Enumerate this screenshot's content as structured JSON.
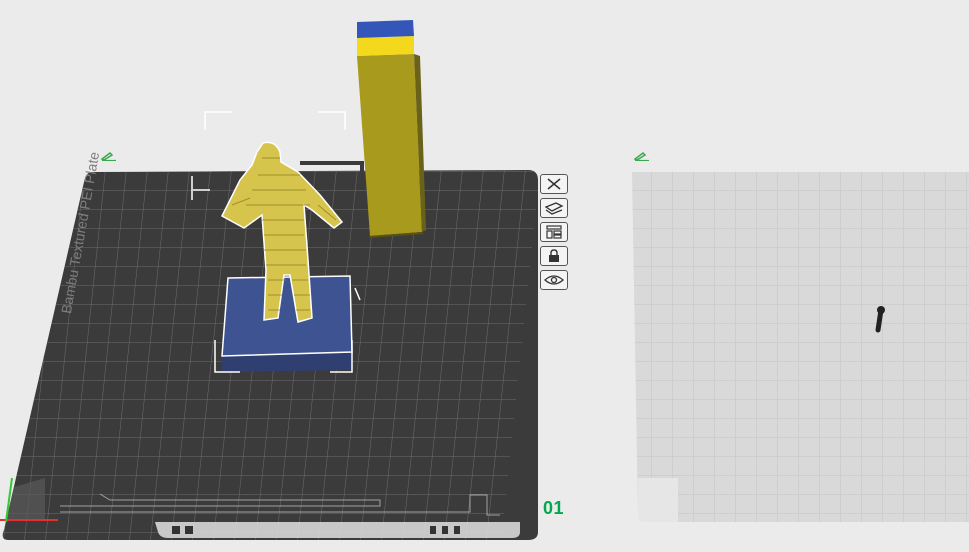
{
  "plate_1": {
    "surface_name": "Bambu Textured PEI Plate",
    "index_label": "01",
    "objects": [
      {
        "name": "figure-model",
        "color": "#d6c44c"
      },
      {
        "name": "base-block",
        "color": "#3e5392"
      },
      {
        "name": "wipe-tower",
        "colors": [
          "#a89a1c",
          "#f4d81c",
          "#3356b8"
        ]
      }
    ],
    "toolbar": [
      {
        "id": "delete-plate",
        "icon": "close-icon"
      },
      {
        "id": "orient-plate",
        "icon": "orient-icon"
      },
      {
        "id": "arrange-plate",
        "icon": "arrange-icon"
      },
      {
        "id": "lock-plate",
        "icon": "lock-icon"
      },
      {
        "id": "plate-settings",
        "icon": "eye-icon"
      }
    ]
  },
  "plate_2": {
    "objects": [
      {
        "name": "small-object",
        "color": "#222222"
      }
    ]
  },
  "colors": {
    "accent": "#00a94f",
    "active_plate": "#3b3b3b",
    "inactive_plate": "#d9d9d9",
    "background": "#ebebeb"
  }
}
